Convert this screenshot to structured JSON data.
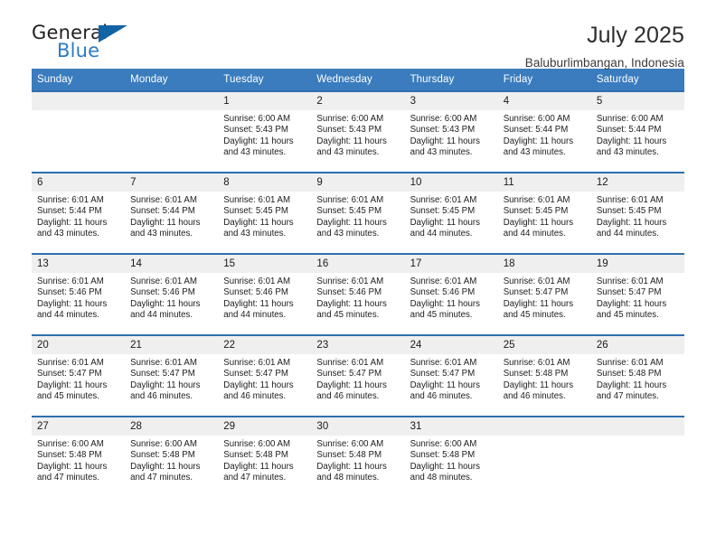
{
  "brand": {
    "word_one": "General",
    "word_two": "Blue",
    "triangle_icon": "triangle-icon",
    "accent_color": "#2b7cc4",
    "triangle_color": "#1263a4"
  },
  "header": {
    "title": "July 2025",
    "location": "Baluburlimbangan, Indonesia"
  },
  "theme": {
    "header_blue": "#3a7cbe",
    "row_border_blue": "#2f6fae",
    "daynum_gray": "#efefef"
  },
  "columns": [
    "Sunday",
    "Monday",
    "Tuesday",
    "Wednesday",
    "Thursday",
    "Friday",
    "Saturday"
  ],
  "labels": {
    "sunrise_prefix": "Sunrise:",
    "sunset_prefix": "Sunset:",
    "daylight_prefix": "Daylight:"
  },
  "weeks": [
    [
      {
        "day": ""
      },
      {
        "day": ""
      },
      {
        "day": "1",
        "sunrise": "Sunrise: 6:00 AM",
        "sunset": "Sunset: 5:43 PM",
        "daylight_line1": "Daylight: 11 hours",
        "daylight_line2": "and 43 minutes."
      },
      {
        "day": "2",
        "sunrise": "Sunrise: 6:00 AM",
        "sunset": "Sunset: 5:43 PM",
        "daylight_line1": "Daylight: 11 hours",
        "daylight_line2": "and 43 minutes."
      },
      {
        "day": "3",
        "sunrise": "Sunrise: 6:00 AM",
        "sunset": "Sunset: 5:43 PM",
        "daylight_line1": "Daylight: 11 hours",
        "daylight_line2": "and 43 minutes."
      },
      {
        "day": "4",
        "sunrise": "Sunrise: 6:00 AM",
        "sunset": "Sunset: 5:44 PM",
        "daylight_line1": "Daylight: 11 hours",
        "daylight_line2": "and 43 minutes."
      },
      {
        "day": "5",
        "sunrise": "Sunrise: 6:00 AM",
        "sunset": "Sunset: 5:44 PM",
        "daylight_line1": "Daylight: 11 hours",
        "daylight_line2": "and 43 minutes."
      }
    ],
    [
      {
        "day": "6",
        "sunrise": "Sunrise: 6:01 AM",
        "sunset": "Sunset: 5:44 PM",
        "daylight_line1": "Daylight: 11 hours",
        "daylight_line2": "and 43 minutes."
      },
      {
        "day": "7",
        "sunrise": "Sunrise: 6:01 AM",
        "sunset": "Sunset: 5:44 PM",
        "daylight_line1": "Daylight: 11 hours",
        "daylight_line2": "and 43 minutes."
      },
      {
        "day": "8",
        "sunrise": "Sunrise: 6:01 AM",
        "sunset": "Sunset: 5:45 PM",
        "daylight_line1": "Daylight: 11 hours",
        "daylight_line2": "and 43 minutes."
      },
      {
        "day": "9",
        "sunrise": "Sunrise: 6:01 AM",
        "sunset": "Sunset: 5:45 PM",
        "daylight_line1": "Daylight: 11 hours",
        "daylight_line2": "and 43 minutes."
      },
      {
        "day": "10",
        "sunrise": "Sunrise: 6:01 AM",
        "sunset": "Sunset: 5:45 PM",
        "daylight_line1": "Daylight: 11 hours",
        "daylight_line2": "and 44 minutes."
      },
      {
        "day": "11",
        "sunrise": "Sunrise: 6:01 AM",
        "sunset": "Sunset: 5:45 PM",
        "daylight_line1": "Daylight: 11 hours",
        "daylight_line2": "and 44 minutes."
      },
      {
        "day": "12",
        "sunrise": "Sunrise: 6:01 AM",
        "sunset": "Sunset: 5:45 PM",
        "daylight_line1": "Daylight: 11 hours",
        "daylight_line2": "and 44 minutes."
      }
    ],
    [
      {
        "day": "13",
        "sunrise": "Sunrise: 6:01 AM",
        "sunset": "Sunset: 5:46 PM",
        "daylight_line1": "Daylight: 11 hours",
        "daylight_line2": "and 44 minutes."
      },
      {
        "day": "14",
        "sunrise": "Sunrise: 6:01 AM",
        "sunset": "Sunset: 5:46 PM",
        "daylight_line1": "Daylight: 11 hours",
        "daylight_line2": "and 44 minutes."
      },
      {
        "day": "15",
        "sunrise": "Sunrise: 6:01 AM",
        "sunset": "Sunset: 5:46 PM",
        "daylight_line1": "Daylight: 11 hours",
        "daylight_line2": "and 44 minutes."
      },
      {
        "day": "16",
        "sunrise": "Sunrise: 6:01 AM",
        "sunset": "Sunset: 5:46 PM",
        "daylight_line1": "Daylight: 11 hours",
        "daylight_line2": "and 45 minutes."
      },
      {
        "day": "17",
        "sunrise": "Sunrise: 6:01 AM",
        "sunset": "Sunset: 5:46 PM",
        "daylight_line1": "Daylight: 11 hours",
        "daylight_line2": "and 45 minutes."
      },
      {
        "day": "18",
        "sunrise": "Sunrise: 6:01 AM",
        "sunset": "Sunset: 5:47 PM",
        "daylight_line1": "Daylight: 11 hours",
        "daylight_line2": "and 45 minutes."
      },
      {
        "day": "19",
        "sunrise": "Sunrise: 6:01 AM",
        "sunset": "Sunset: 5:47 PM",
        "daylight_line1": "Daylight: 11 hours",
        "daylight_line2": "and 45 minutes."
      }
    ],
    [
      {
        "day": "20",
        "sunrise": "Sunrise: 6:01 AM",
        "sunset": "Sunset: 5:47 PM",
        "daylight_line1": "Daylight: 11 hours",
        "daylight_line2": "and 45 minutes."
      },
      {
        "day": "21",
        "sunrise": "Sunrise: 6:01 AM",
        "sunset": "Sunset: 5:47 PM",
        "daylight_line1": "Daylight: 11 hours",
        "daylight_line2": "and 46 minutes."
      },
      {
        "day": "22",
        "sunrise": "Sunrise: 6:01 AM",
        "sunset": "Sunset: 5:47 PM",
        "daylight_line1": "Daylight: 11 hours",
        "daylight_line2": "and 46 minutes."
      },
      {
        "day": "23",
        "sunrise": "Sunrise: 6:01 AM",
        "sunset": "Sunset: 5:47 PM",
        "daylight_line1": "Daylight: 11 hours",
        "daylight_line2": "and 46 minutes."
      },
      {
        "day": "24",
        "sunrise": "Sunrise: 6:01 AM",
        "sunset": "Sunset: 5:47 PM",
        "daylight_line1": "Daylight: 11 hours",
        "daylight_line2": "and 46 minutes."
      },
      {
        "day": "25",
        "sunrise": "Sunrise: 6:01 AM",
        "sunset": "Sunset: 5:48 PM",
        "daylight_line1": "Daylight: 11 hours",
        "daylight_line2": "and 46 minutes."
      },
      {
        "day": "26",
        "sunrise": "Sunrise: 6:01 AM",
        "sunset": "Sunset: 5:48 PM",
        "daylight_line1": "Daylight: 11 hours",
        "daylight_line2": "and 47 minutes."
      }
    ],
    [
      {
        "day": "27",
        "sunrise": "Sunrise: 6:00 AM",
        "sunset": "Sunset: 5:48 PM",
        "daylight_line1": "Daylight: 11 hours",
        "daylight_line2": "and 47 minutes."
      },
      {
        "day": "28",
        "sunrise": "Sunrise: 6:00 AM",
        "sunset": "Sunset: 5:48 PM",
        "daylight_line1": "Daylight: 11 hours",
        "daylight_line2": "and 47 minutes."
      },
      {
        "day": "29",
        "sunrise": "Sunrise: 6:00 AM",
        "sunset": "Sunset: 5:48 PM",
        "daylight_line1": "Daylight: 11 hours",
        "daylight_line2": "and 47 minutes."
      },
      {
        "day": "30",
        "sunrise": "Sunrise: 6:00 AM",
        "sunset": "Sunset: 5:48 PM",
        "daylight_line1": "Daylight: 11 hours",
        "daylight_line2": "and 48 minutes."
      },
      {
        "day": "31",
        "sunrise": "Sunrise: 6:00 AM",
        "sunset": "Sunset: 5:48 PM",
        "daylight_line1": "Daylight: 11 hours",
        "daylight_line2": "and 48 minutes."
      },
      {
        "day": ""
      },
      {
        "day": ""
      }
    ]
  ]
}
